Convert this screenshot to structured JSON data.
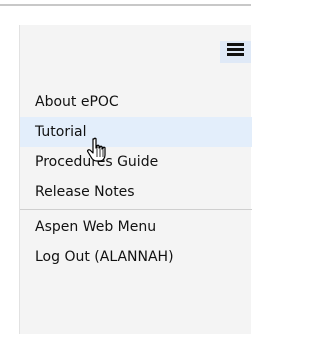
{
  "menu": {
    "toggle_icon": "hamburger-menu-icon",
    "cursor_icon": "hand-pointer-cursor-icon",
    "highlight_color": "#e3eefb",
    "items": [
      {
        "label": "About ePOC"
      },
      {
        "label": "Tutorial"
      },
      {
        "label": "Procedures Guide"
      },
      {
        "label": "Release Notes"
      },
      {
        "label": "Aspen Web Menu"
      },
      {
        "label": "Log Out (ALANNAH)"
      }
    ]
  }
}
